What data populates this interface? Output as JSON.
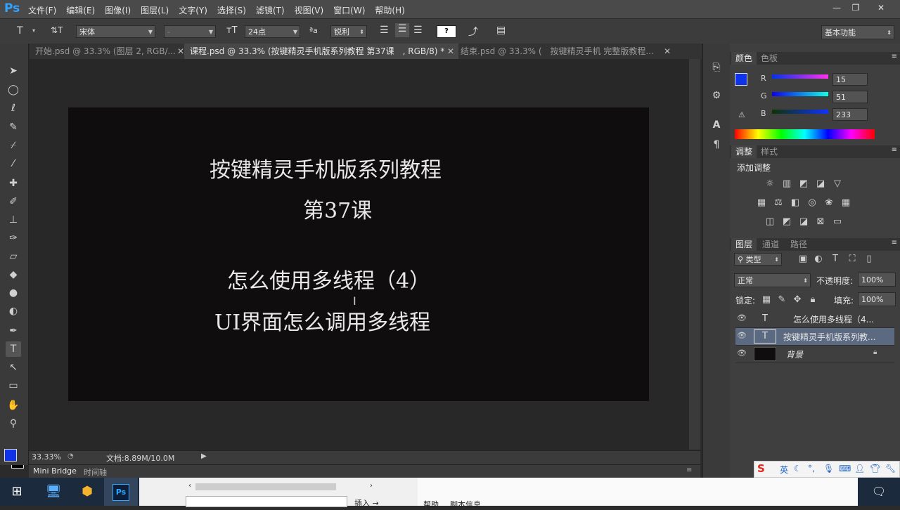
{
  "app": {
    "logo": "Ps"
  },
  "menu": [
    "文件(F)",
    "编辑(E)",
    "图像(I)",
    "图层(L)",
    "文字(Y)",
    "选择(S)",
    "滤镜(T)",
    "视图(V)",
    "窗口(W)",
    "帮助(H)"
  ],
  "window_buttons": {
    "minimize": "—",
    "restore": "❐",
    "close": "✕"
  },
  "options_bar": {
    "tool_icon": "T",
    "orient_icon": "⇅T",
    "font_family": "宋体",
    "font_style": "-",
    "font_size": "24点",
    "aa_icon": "ªa",
    "anti_alias": "锐利",
    "color_swatch_label": "?",
    "workspace": "基本功能"
  },
  "tabs": [
    {
      "label": "开始.psd @ 33.3% (图层 2, RGB/..."
    },
    {
      "label": "课程.psd @ 33.3% (按键精灵手机版系列教程 第37课　, RGB/8) *"
    },
    {
      "label": "结束.psd @ 33.3% (　按键精灵手机 完整版教程..."
    }
  ],
  "canvas_text": {
    "line1": "按键精灵手机版系列教程",
    "line2": "第37课",
    "line3": "怎么使用多线程（4）",
    "line4": "UI界面怎么调用多线程"
  },
  "status": {
    "zoom": "33.33%",
    "doc": "文档:8.89M/10.0M"
  },
  "bottom_tabs": [
    "Mini Bridge",
    "时间轴"
  ],
  "color_panel": {
    "tabs": [
      "颜色",
      "色板"
    ],
    "r_label": "R",
    "g_label": "G",
    "b_label": "B",
    "r": "15",
    "g": "51",
    "b": "233",
    "fg_color": "#0f33e9"
  },
  "adjust_panel": {
    "tabs": [
      "调整",
      "样式"
    ],
    "title": "添加调整"
  },
  "layers_panel": {
    "tabs": [
      "图层",
      "通道",
      "路径"
    ],
    "filter": "类型",
    "blend": "正常",
    "opacity_label": "不透明度:",
    "opacity": "100%",
    "lock_label": "锁定:",
    "fill_label": "填充:",
    "fill": "100%",
    "layers": [
      {
        "name": "怎么使用多线程（4...",
        "type": "T"
      },
      {
        "name": "按键精灵手机版系列教...",
        "type": "T"
      },
      {
        "name": "背景",
        "type": "bg"
      }
    ]
  },
  "bottom_strip": {
    "help_tab": "帮助",
    "script_tab": "脚本信息",
    "insert_btn": "插入 →"
  },
  "ime_logo": "S"
}
